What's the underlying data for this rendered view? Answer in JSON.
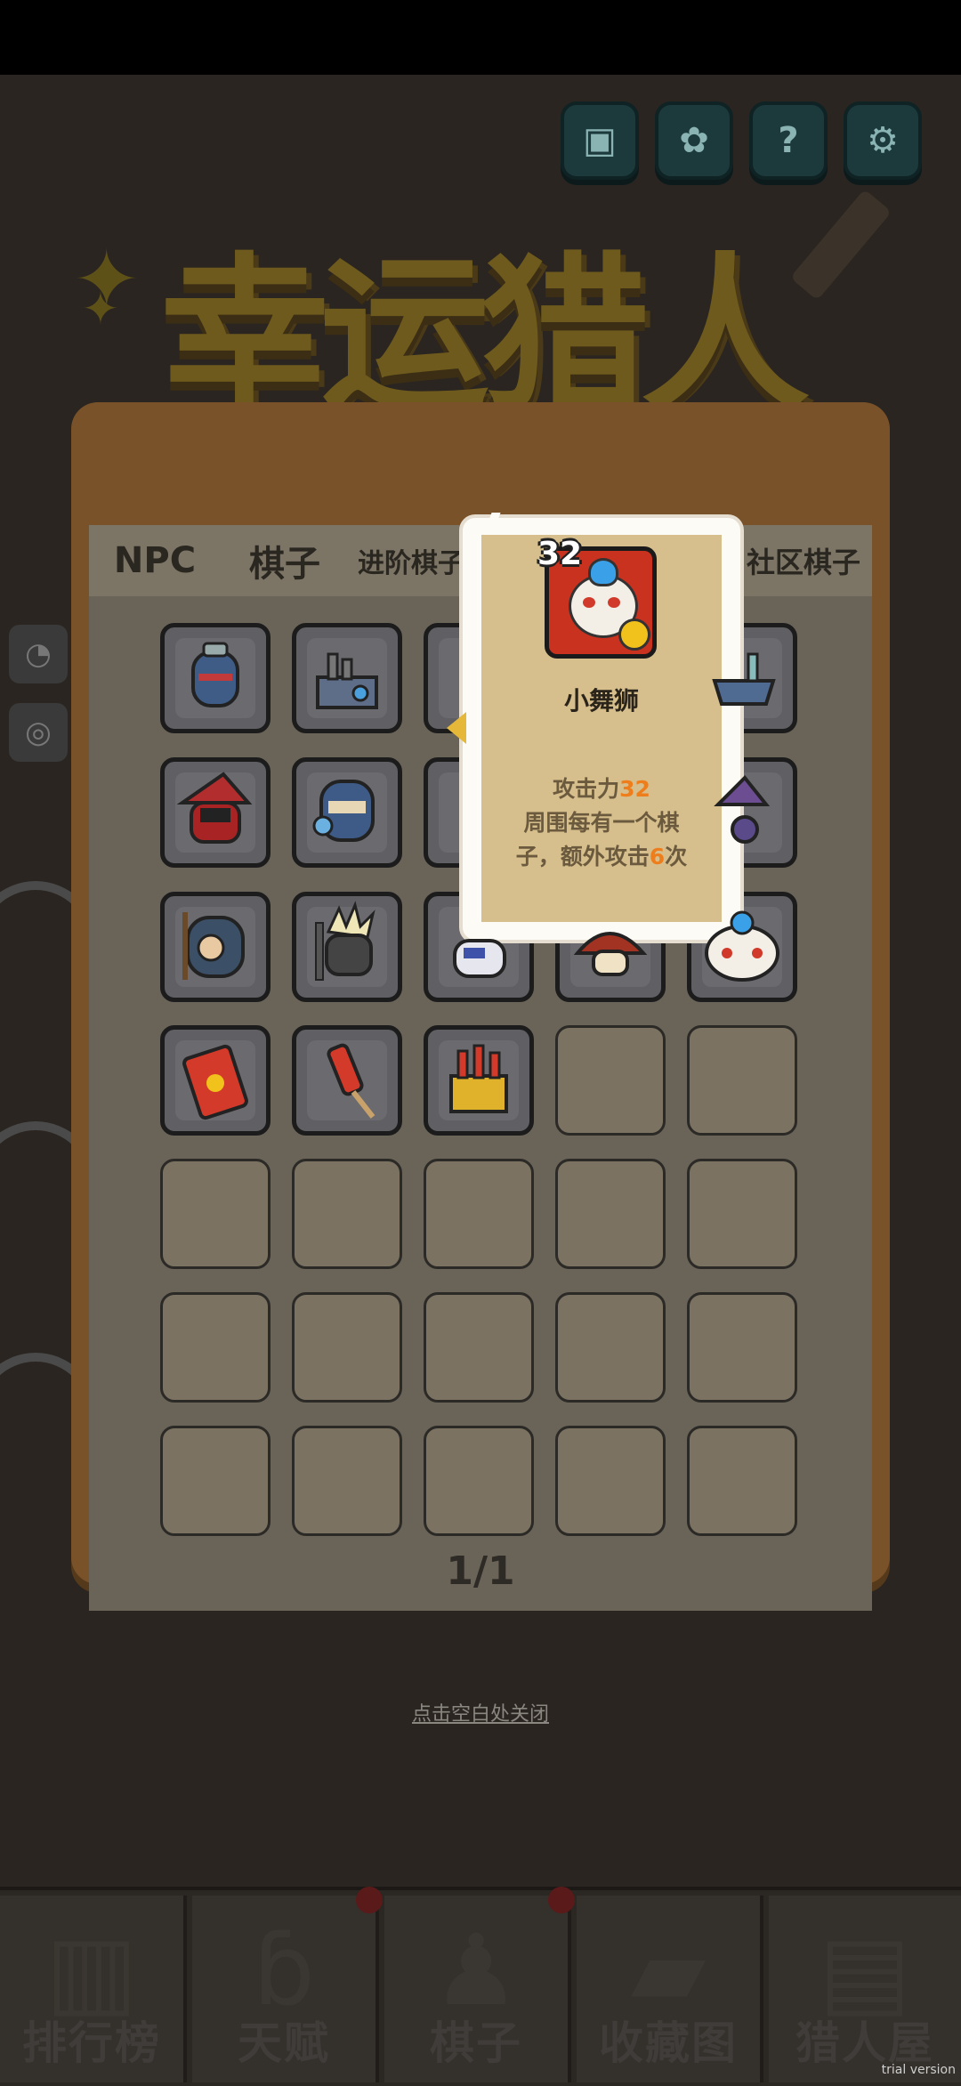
{
  "game": {
    "title": "幸运猎人"
  },
  "top_buttons": [
    {
      "name": "save-icon",
      "glyph": "💾"
    },
    {
      "name": "flower-icon",
      "glyph": "✿"
    },
    {
      "name": "help-icon",
      "glyph": "?"
    },
    {
      "name": "settings-icon",
      "glyph": "⚙"
    }
  ],
  "panel": {
    "tabs": [
      "NPC",
      "棋子",
      "进阶棋子",
      "社区棋子"
    ],
    "page_indicator": "1/1",
    "close_hint": "点击空白处关闭"
  },
  "tooltip": {
    "level": "32",
    "unit_name": "小舞狮",
    "attack_label": "攻击力",
    "attack_value": "32",
    "desc_line1": "周围每有一个棋",
    "desc_line2_prefix": "子，额外攻击",
    "desc_line2_value": "6",
    "desc_line2_suffix": "次"
  },
  "bottom_nav": [
    {
      "label": "排行榜",
      "icon": "leaderboard-icon"
    },
    {
      "label": "天赋",
      "icon": "muscle-icon"
    },
    {
      "label": "棋子",
      "icon": "pieces-icon"
    },
    {
      "label": "收藏图",
      "icon": "collection-book-icon"
    },
    {
      "label": "猎人屋",
      "icon": "hunter-house-icon"
    }
  ],
  "watermark": "trial version",
  "colors": {
    "accent_orange": "#ee7d1c",
    "panel_brown": "#7a5229",
    "card_tan": "#d6bf8c"
  }
}
